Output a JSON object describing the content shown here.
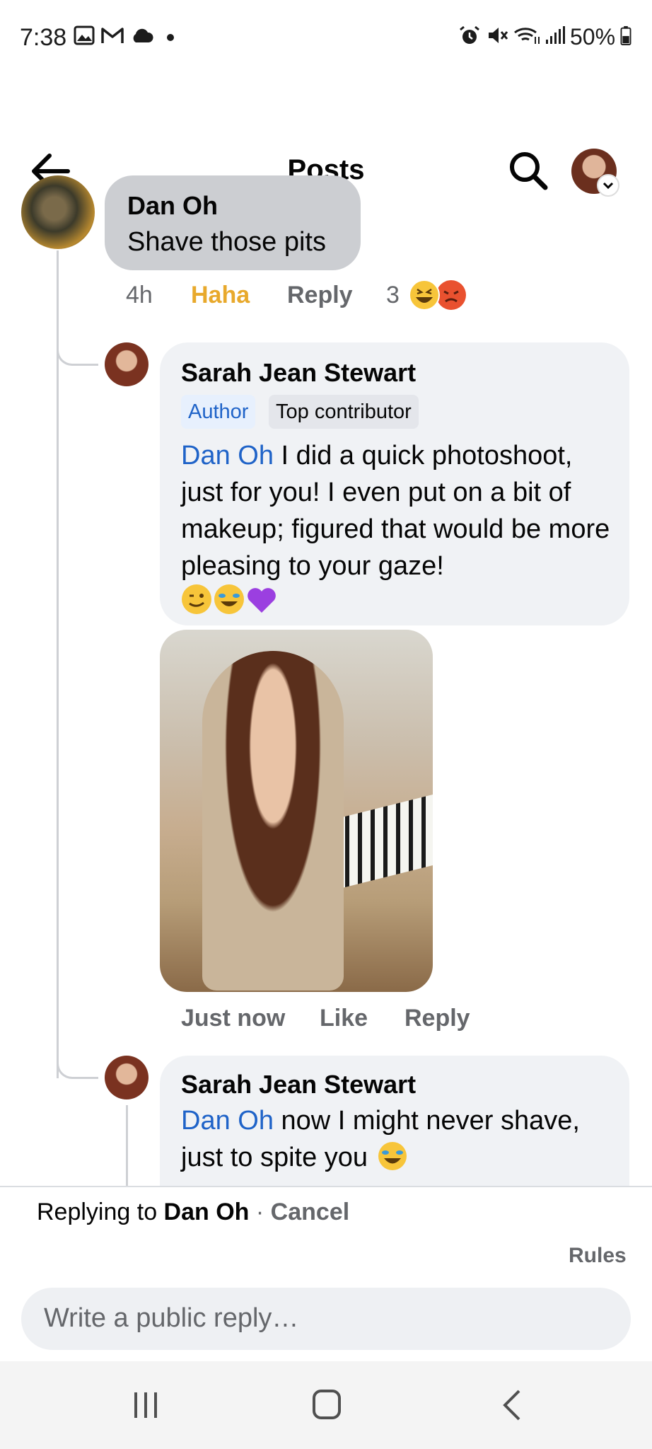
{
  "status_bar": {
    "time": "7:38",
    "battery": "50%",
    "icons": [
      "image-icon",
      "gmail-icon",
      "cloud-icon",
      "dot-icon",
      "alarm-icon",
      "mute-icon",
      "wifi-icon",
      "signal-icon",
      "battery-icon"
    ]
  },
  "header": {
    "title": "Posts",
    "back_icon": "arrow-left-icon",
    "search_icon": "search-icon"
  },
  "comments": [
    {
      "author": "Dan Oh",
      "text": "Shave those pits",
      "time": "4h",
      "reaction_label": "Haha",
      "reply_label": "Reply",
      "reaction_count": "3",
      "reaction_icons": [
        "haha-emoji",
        "angry-emoji"
      ]
    },
    {
      "author": "Sarah Jean Stewart",
      "badges": [
        "Author",
        "Top contributor"
      ],
      "mention": "Dan Oh",
      "text": " I did a quick photoshoot, just for you! I even put on a bit of makeup; figured that would be more pleasing to your gaze!",
      "emojis": [
        "wink-emoji",
        "rofl-emoji",
        "purple-heart-emoji"
      ],
      "time": "Just now",
      "like_label": "Like",
      "reply_label": "Reply"
    },
    {
      "author": "Sarah Jean Stewart",
      "mention": "Dan Oh",
      "text": " now I might never shave, just to spite you",
      "emojis": [
        "rofl-emoji"
      ]
    }
  ],
  "reply_bar": {
    "prefix": "Replying to ",
    "target": "Dan Oh",
    "separator": " · ",
    "cancel": "Cancel",
    "rules": "Rules",
    "placeholder": "Write a public reply…"
  },
  "colors": {
    "mention": "#1f63c8",
    "haha": "#e8a92c",
    "author_badge_bg": "#e7f0fd",
    "bubble_gray": "#ccced2",
    "bubble_light": "#f0f2f5"
  }
}
